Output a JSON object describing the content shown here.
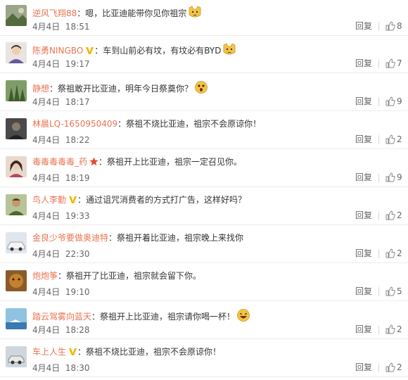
{
  "reply_label": "回复",
  "colors": {
    "username": "#eb7350",
    "text": "#333333",
    "meta": "#666666",
    "vip": "#f5b400",
    "star": "#e24a2c"
  },
  "comments": [
    {
      "user": "逆风飞翔88",
      "sep": "：",
      "text": "嗯，比亚迪能带你见你祖宗",
      "emoji": "cat-face",
      "date": "4月4日",
      "time": "18:51",
      "likes": "8",
      "badge": ""
    },
    {
      "user": "陈勇NINGBO",
      "sep": "：",
      "text": "车到山前必有坟，有坟必有BYD",
      "emoji": "cat-face",
      "date": "4月4日",
      "time": "19:17",
      "likes": "7",
      "badge": "vip"
    },
    {
      "user": "静想",
      "sep": "：",
      "text": "祭祖敢开比亚迪，明年今日祭奠你？",
      "emoji": "shocked-face",
      "date": "4月4日",
      "time": "18:17",
      "likes": "9",
      "badge": ""
    },
    {
      "user": "林晨LQ-1650950409",
      "sep": "：",
      "text": "祭祖不烧比亚迪，祖宗不会原谅你！",
      "emoji": "",
      "date": "4月4日",
      "time": "18:22",
      "likes": "2",
      "badge": ""
    },
    {
      "user": "毒毒毒毒毒_药",
      "sep": "：",
      "text": "祭祖开上比亚迪，祖宗一定召见你。",
      "emoji": "",
      "date": "4月4日",
      "time": "18:19",
      "likes": "9",
      "badge": "star"
    },
    {
      "user": "鸟人李勤",
      "sep": "：",
      "text": "通过诅咒消费者的方式打广告，这样好吗？",
      "emoji": "",
      "date": "4月4日",
      "time": "19:33",
      "likes": "2",
      "badge": "vip"
    },
    {
      "user": "金良少爷要做奥迪特",
      "sep": "：",
      "text": "祭祖开着比亚迪，祖宗晚上来找你",
      "emoji": "",
      "date": "4月4日",
      "time": "22:30",
      "likes": "2",
      "badge": ""
    },
    {
      "user": "炮炮筝",
      "sep": "：",
      "text": "祭祖开了比亚迪，祖宗就会留下你。",
      "emoji": "",
      "date": "4月4日",
      "time": "19:10",
      "likes": "5",
      "badge": ""
    },
    {
      "user": "踏云驾雾向蓝天",
      "sep": "：",
      "text": "祭祖开上比亚迪，祖宗请你喝一杯！",
      "emoji": "laughing-face",
      "date": "4月4日",
      "time": "18:28",
      "likes": "2",
      "badge": ""
    },
    {
      "user": "车上人生",
      "sep": "：",
      "text": "祭祖不烧比亚迪，祖宗不会原谅你！",
      "emoji": "",
      "date": "4月4日",
      "time": "18:30",
      "likes": "2",
      "badge": "vip"
    }
  ]
}
